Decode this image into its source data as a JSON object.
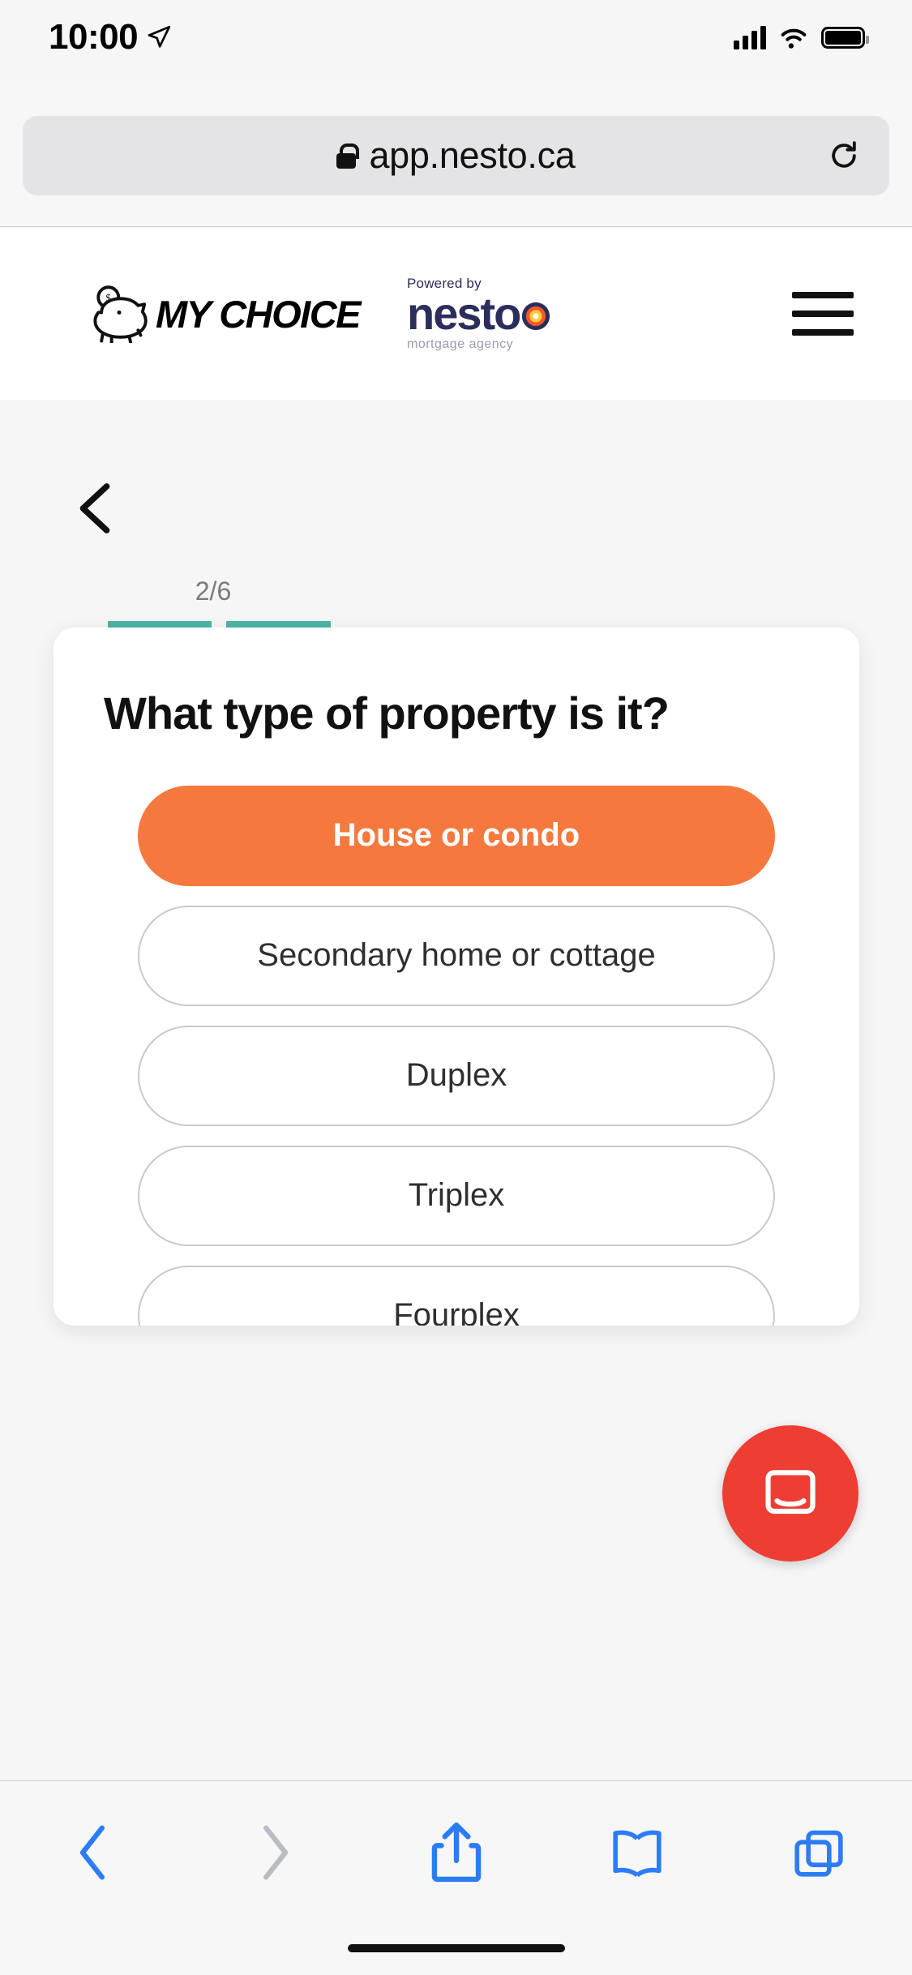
{
  "status_bar": {
    "time": "10:00",
    "location_icon": "location-arrow-icon",
    "signal_icon": "cellular-bars-icon",
    "wifi_icon": "wifi-icon",
    "battery_icon": "battery-full-icon"
  },
  "browser": {
    "url": "app.nesto.ca",
    "lock_icon": "lock-icon",
    "reload_icon": "reload-icon",
    "toolbar": {
      "back_icon": "chevron-left-icon",
      "forward_icon": "chevron-right-icon",
      "share_icon": "share-icon",
      "bookmarks_icon": "book-icon",
      "tabs_icon": "tabs-icon"
    }
  },
  "site_header": {
    "brand_name": "MY CHOICE",
    "brand_icon": "piggy-bank-icon",
    "powered_by": "Powered by",
    "partner_name": "nesto",
    "partner_tagline": "mortgage agency",
    "menu_icon": "hamburger-menu-icon"
  },
  "page": {
    "back_icon": "chevron-left-icon",
    "progress": {
      "label": "2/6",
      "current": 2,
      "total": 6
    },
    "question": "What type of property is it?",
    "options": [
      {
        "label": "House or condo",
        "selected": true
      },
      {
        "label": "Secondary home or cottage",
        "selected": false
      },
      {
        "label": "Duplex",
        "selected": false
      },
      {
        "label": "Triplex",
        "selected": false
      },
      {
        "label": "Fourplex",
        "selected": false
      }
    ]
  },
  "support": {
    "widget_icon": "intercom-chat-icon"
  },
  "colors": {
    "accent_orange": "#f5793e",
    "progress_teal": "#4bb5a5",
    "brand_navy": "#2b2d5c",
    "intercom_red": "#ee3d33",
    "safari_blue": "#2c7cf6"
  }
}
